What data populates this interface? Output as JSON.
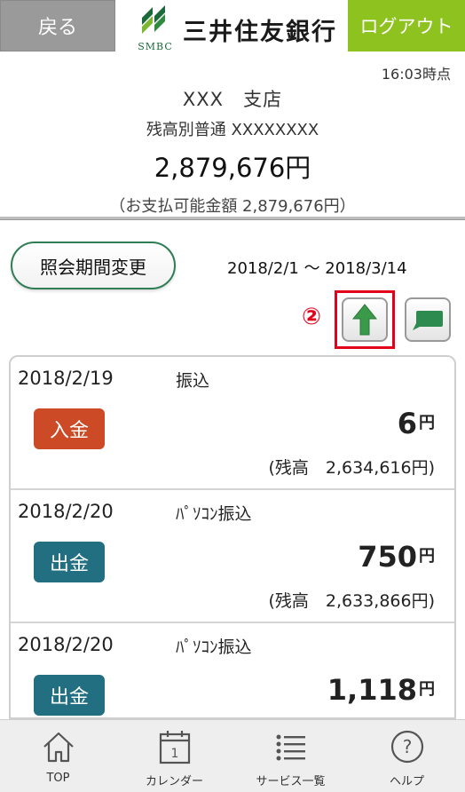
{
  "header": {
    "back_label": "戻る",
    "logout_label": "ログアウト",
    "logo_sub": "SMBC",
    "logo_name": "三井住友銀行"
  },
  "time": "16:03時点",
  "account": {
    "branch": "XXX　支店",
    "type": "残高別普通 XXXXXXXX",
    "balance": "2,879,676円",
    "available": "（お支払可能金額 2,879,676円）"
  },
  "period": {
    "button_label": "照会期間変更",
    "range": "2018/2/1 ～ 2018/3/14"
  },
  "annotation": {
    "step": "②",
    "color": "#e3001b"
  },
  "colors": {
    "deposit": "#cc4a25",
    "withdrawal": "#236f82",
    "brand_green": "#8dc21f"
  },
  "transactions": [
    {
      "date": "2018/2/19",
      "description": "振込",
      "type_label": "入金",
      "type": "in",
      "amount": "6",
      "unit": "円",
      "balance_text": "(残高　2,634,616円)"
    },
    {
      "date": "2018/2/20",
      "description": "ﾊﾟｿｺﾝ振込",
      "type_label": "出金",
      "type": "out",
      "amount": "750",
      "unit": "円",
      "balance_text": "(残高　2,633,866円)"
    },
    {
      "date": "2018/2/20",
      "description": "ﾊﾟｿｺﾝ振込",
      "type_label": "出金",
      "type": "out",
      "amount": "1,118",
      "unit": "円",
      "balance_text": ""
    }
  ],
  "nav": [
    {
      "label": "TOP",
      "icon": "home-icon"
    },
    {
      "label": "カレンダー",
      "icon": "calendar-icon"
    },
    {
      "label": "サービス一覧",
      "icon": "list-icon"
    },
    {
      "label": "ヘルプ",
      "icon": "help-icon"
    }
  ]
}
